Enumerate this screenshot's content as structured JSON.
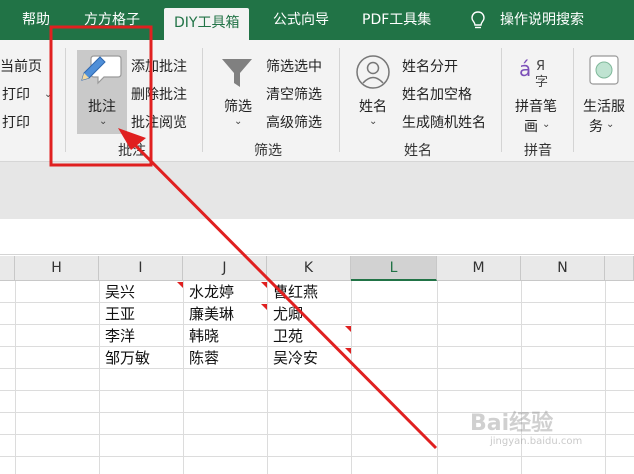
{
  "tabs": [
    {
      "label": "帮助"
    },
    {
      "label": "方方格子"
    },
    {
      "label": "DIY工具箱",
      "active": true
    },
    {
      "label": "公式向导"
    },
    {
      "label": "PDF工具集"
    },
    {
      "label": "操作说明搜索"
    }
  ],
  "ribbon": {
    "print_group": [
      "当前页",
      "打印",
      "打印"
    ],
    "comment_group": {
      "big_button": "批注",
      "items": [
        "添加批注",
        "删除批注",
        "批注阅览"
      ],
      "label": "批注"
    },
    "filter_group": {
      "big_button": "筛选",
      "items": [
        "筛选选中",
        "清空筛选",
        "高级筛选"
      ],
      "label": "筛选"
    },
    "name_group": {
      "big_button": "姓名",
      "items": [
        "姓名分开",
        "姓名加空格",
        "生成随机姓名"
      ],
      "label": "姓名"
    },
    "pinyin_group": {
      "big_button_line1": "拼音笔",
      "big_button_line2": "画",
      "label": "拼音"
    },
    "life_group": {
      "big_button_line1": "生活服",
      "big_button_line2": "务"
    }
  },
  "columns": [
    "H",
    "I",
    "J",
    "K",
    "L",
    "M",
    "N"
  ],
  "rows": [
    [
      "吴兴",
      "水龙婷",
      "曹红燕"
    ],
    [
      "王亚",
      "廉美琳",
      "尤卿"
    ],
    [
      "李洋",
      "韩晓",
      "卫苑"
    ],
    [
      "邹万敏",
      "陈蓉",
      "吴冷安"
    ]
  ],
  "colors": {
    "brand": "#217346",
    "annotation": "#e02020"
  },
  "watermark": {
    "text": "Bai经验",
    "url": "jingyan.baidu.com"
  }
}
